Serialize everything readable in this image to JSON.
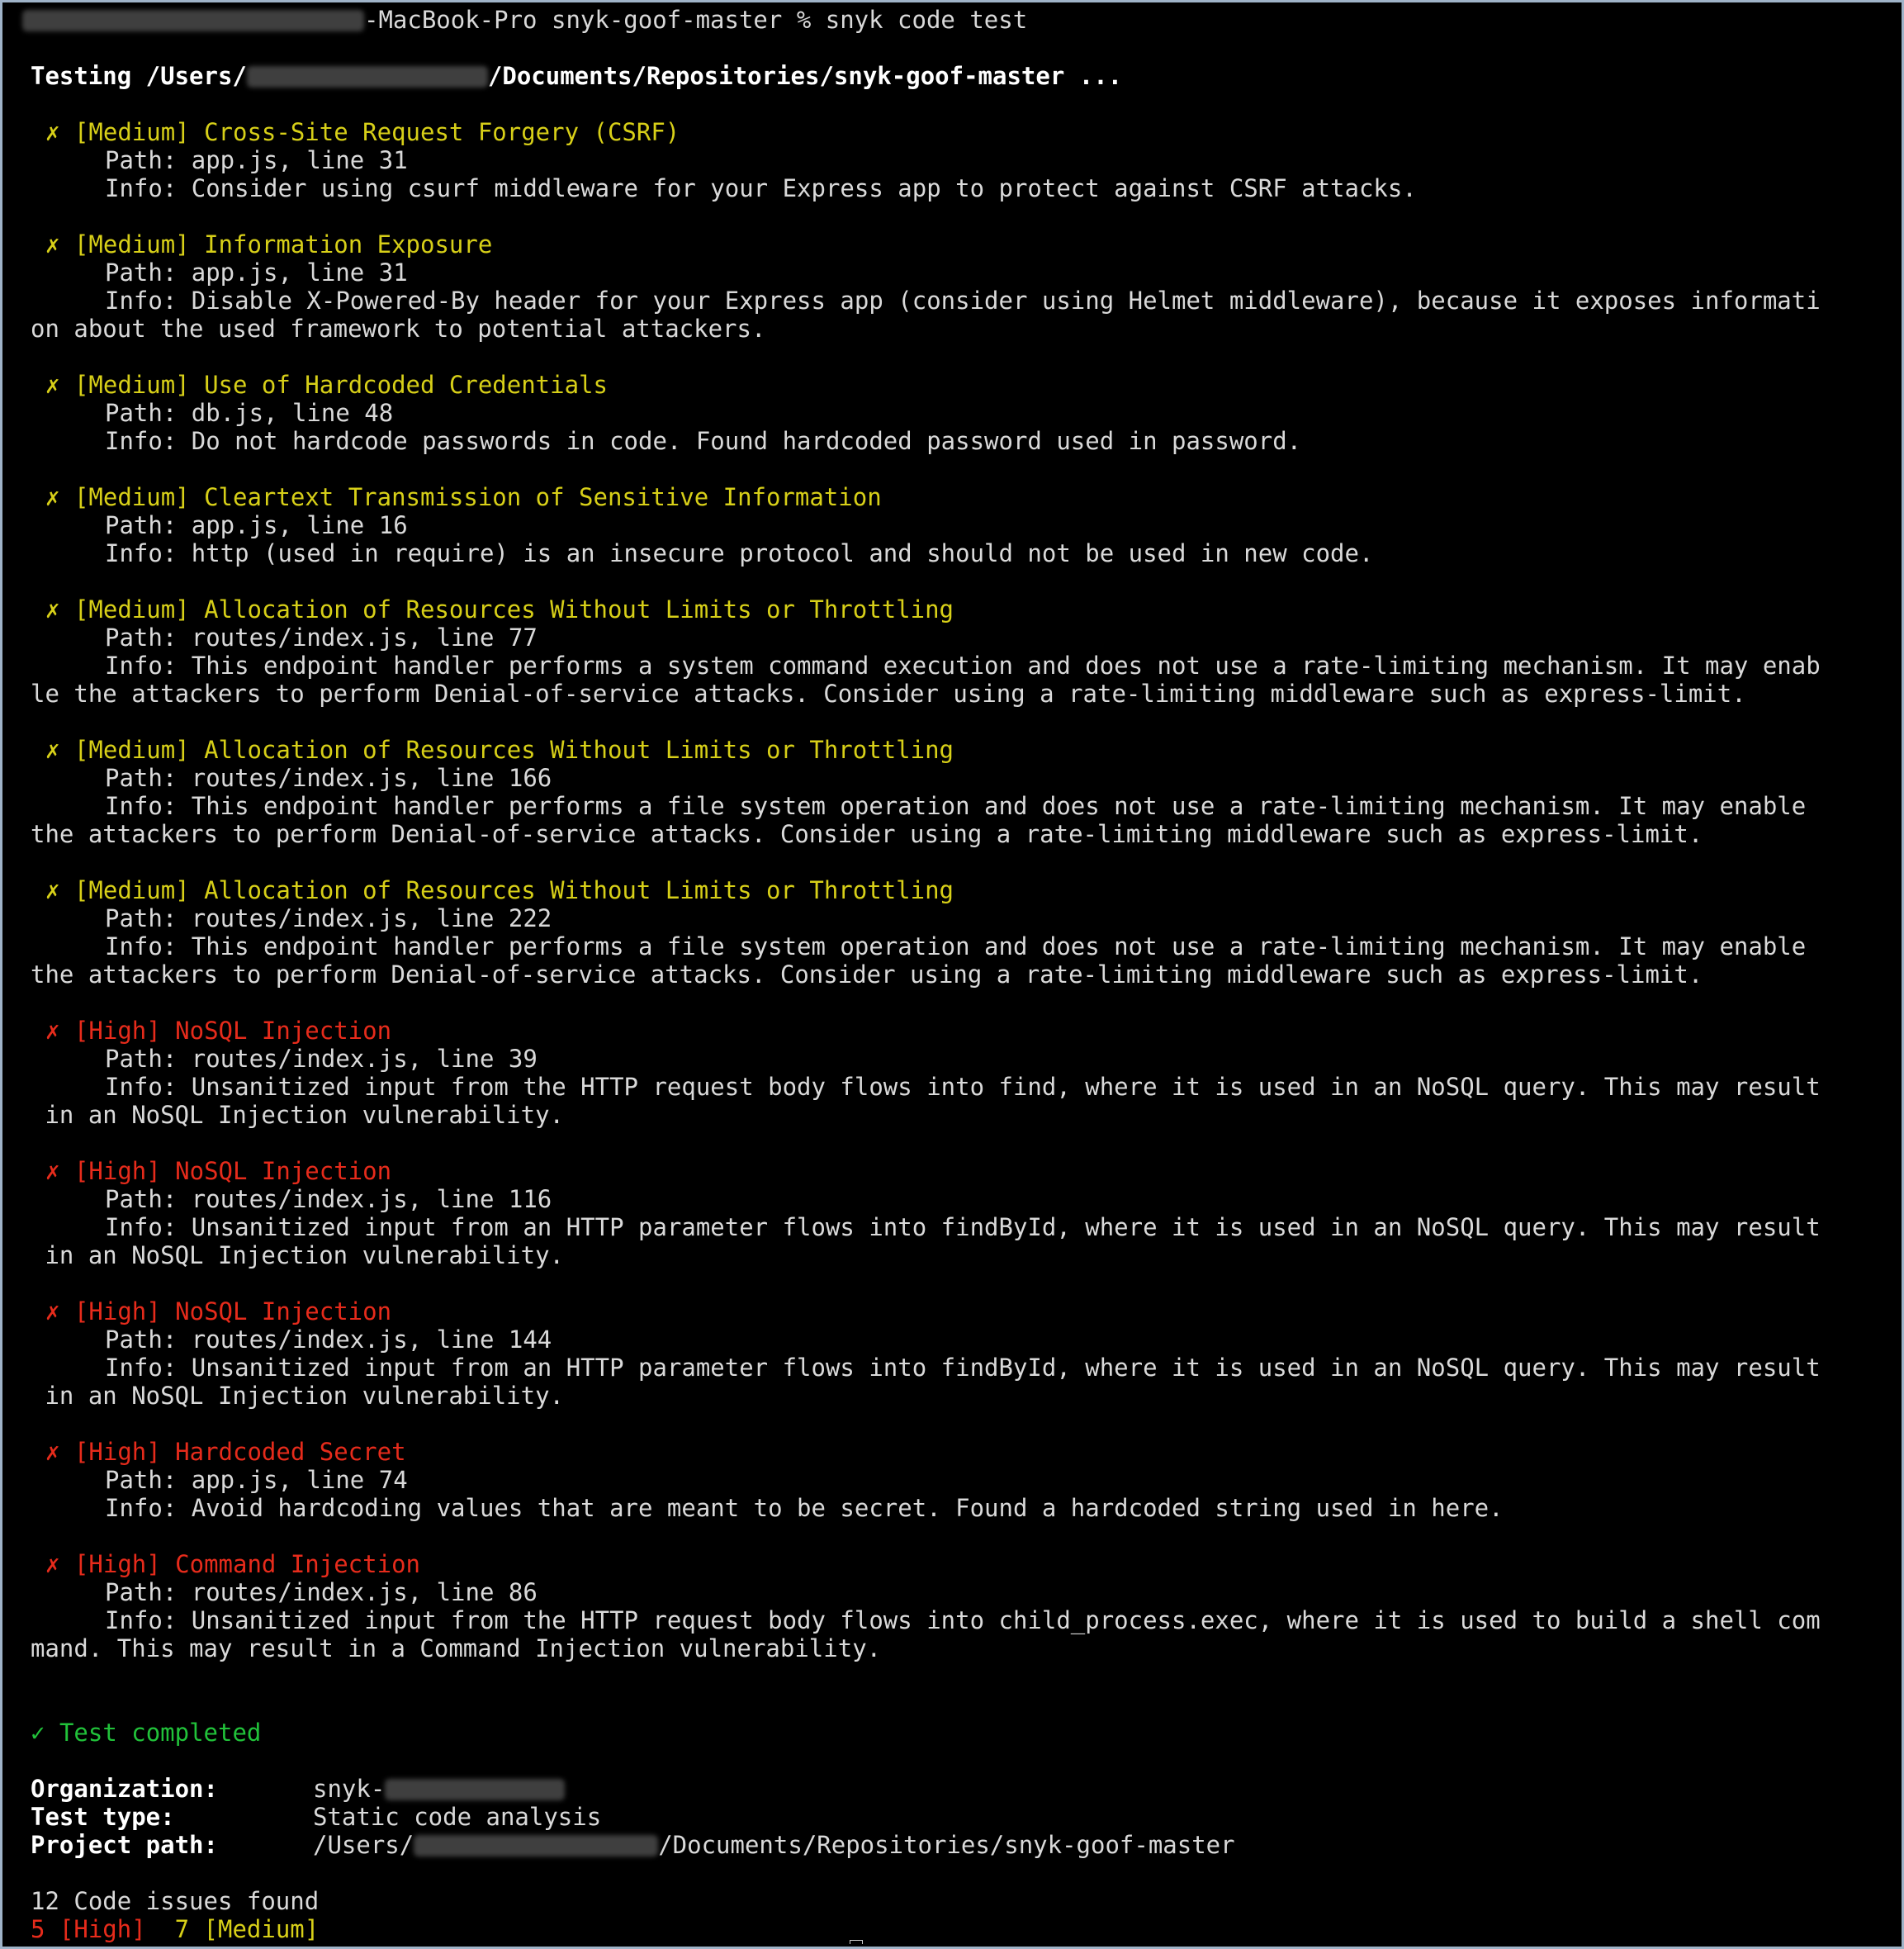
{
  "prompt": {
    "host_suffix": "-MacBook-Pro",
    "directory": "snyk-goof-master",
    "symbol": "%",
    "command": "snyk code test"
  },
  "testing": {
    "prefix": "Testing /Users/",
    "suffix": "/Documents/Repositories/snyk-goof-master ..."
  },
  "findings": [
    {
      "mark": "✗",
      "severity": "[Medium]",
      "title": "Cross-Site Request Forgery (CSRF)",
      "path": "Path: app.js, line 31",
      "info": [
        "Info: Consider using csurf middleware for your Express app to protect against CSRF attacks."
      ]
    },
    {
      "mark": "✗",
      "severity": "[Medium]",
      "title": "Information Exposure",
      "path": "Path: app.js, line 31",
      "info": [
        "Info: Disable X-Powered-By header for your Express app (consider using Helmet middleware), because it exposes informati",
        "on about the used framework to potential attackers."
      ]
    },
    {
      "mark": "✗",
      "severity": "[Medium]",
      "title": "Use of Hardcoded Credentials",
      "path": "Path: db.js, line 48",
      "info": [
        "Info: Do not hardcode passwords in code. Found hardcoded password used in password."
      ]
    },
    {
      "mark": "✗",
      "severity": "[Medium]",
      "title": "Cleartext Transmission of Sensitive Information",
      "path": "Path: app.js, line 16",
      "info": [
        "Info: http (used in require) is an insecure protocol and should not be used in new code."
      ]
    },
    {
      "mark": "✗",
      "severity": "[Medium]",
      "title": "Allocation of Resources Without Limits or Throttling",
      "path": "Path: routes/index.js, line 77",
      "info": [
        "Info: This endpoint handler performs a system command execution and does not use a rate-limiting mechanism. It may enab",
        "le the attackers to perform Denial-of-service attacks. Consider using a rate-limiting middleware such as express-limit."
      ]
    },
    {
      "mark": "✗",
      "severity": "[Medium]",
      "title": "Allocation of Resources Without Limits or Throttling",
      "path": "Path: routes/index.js, line 166",
      "info": [
        "Info: This endpoint handler performs a file system operation and does not use a rate-limiting mechanism. It may enable",
        "the attackers to perform Denial-of-service attacks. Consider using a rate-limiting middleware such as express-limit."
      ]
    },
    {
      "mark": "✗",
      "severity": "[Medium]",
      "title": "Allocation of Resources Without Limits or Throttling",
      "path": "Path: routes/index.js, line 222",
      "info": [
        "Info: This endpoint handler performs a file system operation and does not use a rate-limiting mechanism. It may enable",
        "the attackers to perform Denial-of-service attacks. Consider using a rate-limiting middleware such as express-limit."
      ]
    },
    {
      "mark": "✗",
      "severity": "[High]",
      "title": "NoSQL Injection",
      "path": "Path: routes/index.js, line 39",
      "info": [
        "Info: Unsanitized input from the HTTP request body flows into find, where it is used in an NoSQL query. This may result",
        " in an NoSQL Injection vulnerability."
      ]
    },
    {
      "mark": "✗",
      "severity": "[High]",
      "title": "NoSQL Injection",
      "path": "Path: routes/index.js, line 116",
      "info": [
        "Info: Unsanitized input from an HTTP parameter flows into findById, where it is used in an NoSQL query. This may result",
        " in an NoSQL Injection vulnerability."
      ]
    },
    {
      "mark": "✗",
      "severity": "[High]",
      "title": "NoSQL Injection",
      "path": "Path: routes/index.js, line 144",
      "info": [
        "Info: Unsanitized input from an HTTP parameter flows into findById, where it is used in an NoSQL query. This may result",
        " in an NoSQL Injection vulnerability."
      ]
    },
    {
      "mark": "✗",
      "severity": "[High]",
      "title": "Hardcoded Secret",
      "path": "Path: app.js, line 74",
      "info": [
        "Info: Avoid hardcoding values that are meant to be secret. Found a hardcoded string used in here."
      ]
    },
    {
      "mark": "✗",
      "severity": "[High]",
      "title": "Command Injection",
      "path": "Path: routes/index.js, line 86",
      "info": [
        "Info: Unsanitized input from the HTTP request body flows into child_process.exec, where it is used to build a shell com",
        "mand. This may result in a Command Injection vulnerability."
      ]
    }
  ],
  "completed": {
    "mark": "✓",
    "text": "Test completed"
  },
  "summary": {
    "organization_label": "Organization:",
    "organization_value": "snyk-",
    "test_type_label": "Test type:",
    "test_type_value": "Static code analysis",
    "project_path_label": "Project path:",
    "project_path_prefix": "/Users/",
    "project_path_suffix": "/Documents/Repositories/snyk-goof-master"
  },
  "totals": {
    "issues_found": "12 Code issues found",
    "high": "5 [High]",
    "medium": "7 [Medium]"
  },
  "colors": {
    "background": "#000000",
    "text": "#d9d9d9",
    "medium": "#d7cf18",
    "high": "#e62b1b",
    "success": "#21c23a",
    "border": "#9fb3c8"
  }
}
